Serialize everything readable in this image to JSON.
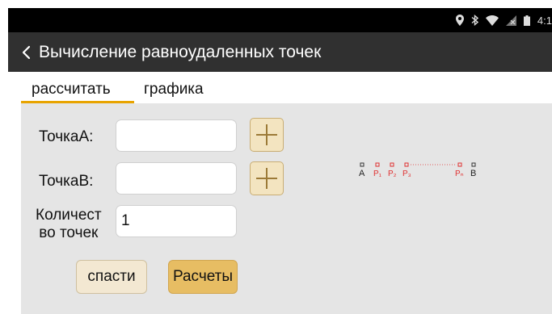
{
  "status_bar": {
    "time": "4:1"
  },
  "app_bar": {
    "title": "Вычисление равноудаленных точек"
  },
  "tabs": [
    {
      "label": "рассчитать",
      "active": true
    },
    {
      "label": "графика",
      "active": false
    }
  ],
  "form": {
    "point_a": {
      "label": "ТочкаA:",
      "value": ""
    },
    "point_b": {
      "label": "ТочкаB:",
      "value": ""
    },
    "count": {
      "label_line1": "Количест",
      "label_line2": "во точек",
      "value": "1"
    }
  },
  "buttons": {
    "save": "спасти",
    "calculate": "Расчеты"
  },
  "diagram": {
    "start_label": "A",
    "end_label": "B",
    "points": [
      "P₁",
      "P₂",
      "P₃",
      "Pₙ"
    ]
  },
  "colors": {
    "accent": "#e8a400",
    "calculate_button": "#e7bd63",
    "save_button": "#f3e8d2",
    "plus_button": "#f3e4c0",
    "app_bar": "#303030",
    "panel": "#e5e5e5",
    "diagram_points": "#e03030"
  }
}
